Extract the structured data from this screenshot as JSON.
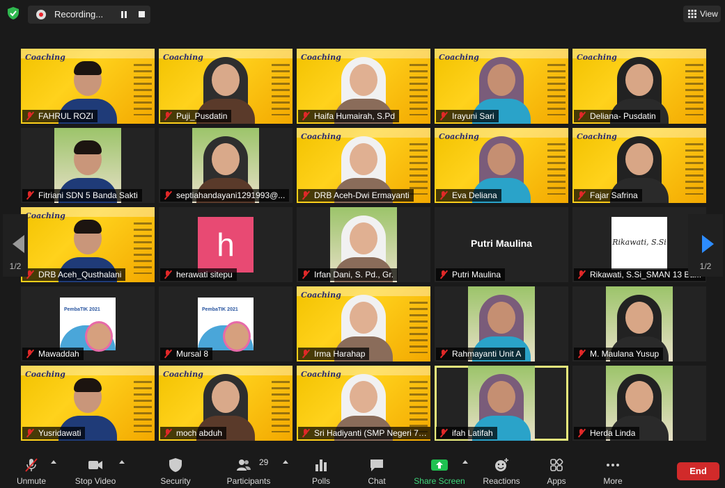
{
  "recording": {
    "label": "Recording..."
  },
  "view": {
    "label": "View"
  },
  "banner_title": "Coaching",
  "pager": {
    "left": "1/2",
    "right": "1/2"
  },
  "participants": [
    {
      "name": "FAHRUL ROZI",
      "bg": "banner"
    },
    {
      "name": "Puji_Pusdatin",
      "bg": "banner"
    },
    {
      "name": "Haifa Humairah, S.Pd",
      "bg": "banner"
    },
    {
      "name": "Irayuni Sari",
      "bg": "banner"
    },
    {
      "name": "Deliana- Pusdatin",
      "bg": "banner"
    },
    {
      "name": "Fitriani SDN 5 Banda Sakti",
      "bg": "photo"
    },
    {
      "name": "septiahandayani1291993@...",
      "bg": "photo"
    },
    {
      "name": "DRB Aceh-Dwi Ermayanti",
      "bg": "banner"
    },
    {
      "name": "Eva Deliana",
      "bg": "banner"
    },
    {
      "name": "Fajar Safrina",
      "bg": "banner"
    },
    {
      "name": "DRB Aceh_Qusthalani",
      "bg": "banner"
    },
    {
      "name": "herawati sitepu",
      "bg": "avatar",
      "avatar_letter": "h",
      "avatar_color": "#e84a73"
    },
    {
      "name": "Irfan Dani, S. Pd., Gr.",
      "bg": "photo"
    },
    {
      "name": "Putri Maulina",
      "bg": "nameonly",
      "display_name": "Putri Maulina"
    },
    {
      "name": "Rikawati, S.Si_SMAN 13 Ba...",
      "bg": "card",
      "card_text": "Rikawati, S.Si"
    },
    {
      "name": "Mawaddah",
      "bg": "poster",
      "poster_title": "PembaTIK 2021"
    },
    {
      "name": "Mursal 8",
      "bg": "poster",
      "poster_title": "PembaTIK 2021"
    },
    {
      "name": "Irma Harahap",
      "bg": "banner"
    },
    {
      "name": "Rahmayanti Unit A",
      "bg": "photo"
    },
    {
      "name": "M. Maulana Yusup",
      "bg": "photo"
    },
    {
      "name": "Yusridawati",
      "bg": "banner"
    },
    {
      "name": "moch abduh",
      "bg": "banner"
    },
    {
      "name": "Sri Hadiyanti (SMP Negeri 7 L...",
      "bg": "banner"
    },
    {
      "name": "ifah Latifah",
      "bg": "photo",
      "active": true
    },
    {
      "name": "Herda Linda",
      "bg": "photo"
    }
  ],
  "toolbar": {
    "unmute": "Unmute",
    "stop_video": "Stop Video",
    "security": "Security",
    "participants": "Participants",
    "participants_count": "29",
    "polls": "Polls",
    "chat": "Chat",
    "share_screen": "Share Screen",
    "reactions": "Reactions",
    "apps": "Apps",
    "more": "More",
    "end": "End"
  },
  "colors": {
    "accent": "#2d8cff",
    "share": "#3fd67a",
    "end": "#d12a2a",
    "active_border": "#e6ea7c"
  }
}
